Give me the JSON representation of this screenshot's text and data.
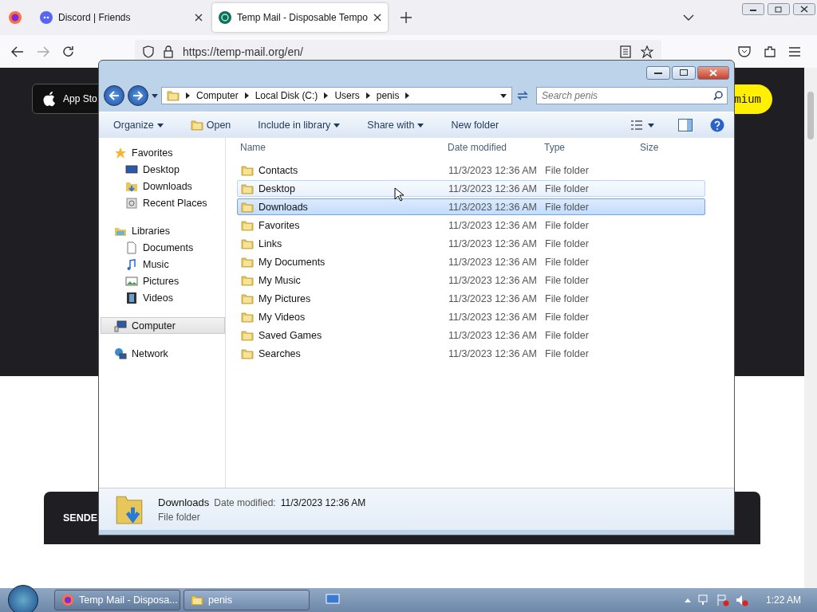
{
  "browser": {
    "tabs": [
      {
        "title": "Discord | Friends",
        "kind": "discord",
        "selected": false
      },
      {
        "title": "Temp Mail - Disposable Tempo",
        "kind": "tempmail",
        "selected": true
      }
    ],
    "url": "https://temp-mail.org/en/"
  },
  "page": {
    "app_button": "App Sto",
    "premium_button": "mium",
    "banner_text": "SENDE"
  },
  "explorer": {
    "path": [
      "Computer",
      "Local Disk (C:)",
      "Users",
      "penis"
    ],
    "search": {
      "placeholder": "Search penis"
    },
    "toolbar": [
      {
        "label": "Organize",
        "dropdown": true,
        "kind": "plain"
      },
      {
        "label": "Open",
        "dropdown": false,
        "kind": "open"
      },
      {
        "label": "Include in library",
        "dropdown": true,
        "kind": "plain"
      },
      {
        "label": "Share with",
        "dropdown": true,
        "kind": "plain"
      },
      {
        "label": "New folder",
        "dropdown": false,
        "kind": "plain"
      }
    ],
    "sidebar": [
      {
        "label": "Favorites",
        "kind": "star",
        "selected": false,
        "children": [
          {
            "label": "Desktop",
            "kind": "desktop",
            "selected": false
          },
          {
            "label": "Downloads",
            "kind": "downloads",
            "selected": false
          },
          {
            "label": "Recent Places",
            "kind": "recent",
            "selected": false
          }
        ]
      },
      {
        "label": "Libraries",
        "kind": "library",
        "selected": false,
        "children": [
          {
            "label": "Documents",
            "kind": "document",
            "selected": false
          },
          {
            "label": "Music",
            "kind": "music",
            "selected": false
          },
          {
            "label": "Pictures",
            "kind": "pictures",
            "selected": false
          },
          {
            "label": "Videos",
            "kind": "videos",
            "selected": false
          }
        ]
      },
      {
        "label": "Computer",
        "kind": "computer",
        "selected": true
      },
      {
        "label": "Network",
        "kind": "network",
        "selected": false
      }
    ],
    "columns": [
      "Name",
      "Date modified",
      "Type",
      "Size"
    ],
    "rows": [
      {
        "name": "Contacts",
        "date": "11/3/2023 12:36 AM",
        "type": "File folder",
        "selected": false,
        "hovered": false
      },
      {
        "name": "Desktop",
        "date": "11/3/2023 12:36 AM",
        "type": "File folder",
        "selected": false,
        "hovered": true
      },
      {
        "name": "Downloads",
        "date": "11/3/2023 12:36 AM",
        "type": "File folder",
        "selected": true,
        "hovered": false
      },
      {
        "name": "Favorites",
        "date": "11/3/2023 12:36 AM",
        "type": "File folder",
        "selected": false,
        "hovered": false
      },
      {
        "name": "Links",
        "date": "11/3/2023 12:36 AM",
        "type": "File folder",
        "selected": false,
        "hovered": false
      },
      {
        "name": "My Documents",
        "date": "11/3/2023 12:36 AM",
        "type": "File folder",
        "selected": false,
        "hovered": false
      },
      {
        "name": "My Music",
        "date": "11/3/2023 12:36 AM",
        "type": "File folder",
        "selected": false,
        "hovered": false
      },
      {
        "name": "My Pictures",
        "date": "11/3/2023 12:36 AM",
        "type": "File folder",
        "selected": false,
        "hovered": false
      },
      {
        "name": "My Videos",
        "date": "11/3/2023 12:36 AM",
        "type": "File folder",
        "selected": false,
        "hovered": false
      },
      {
        "name": "Saved Games",
        "date": "11/3/2023 12:36 AM",
        "type": "File folder",
        "selected": false,
        "hovered": false
      },
      {
        "name": "Searches",
        "date": "11/3/2023 12:36 AM",
        "type": "File folder",
        "selected": false,
        "hovered": false
      }
    ],
    "details": {
      "name": "Downloads",
      "date_label": "Date modified:",
      "date": "11/3/2023 12:36 AM",
      "type": "File folder"
    }
  },
  "taskbar": {
    "items": [
      {
        "label": "Temp Mail - Disposa...",
        "kind": "firefox",
        "selected": false
      },
      {
        "label": "penis",
        "kind": "folder",
        "selected": true
      }
    ],
    "clock": "1:22 AM"
  }
}
